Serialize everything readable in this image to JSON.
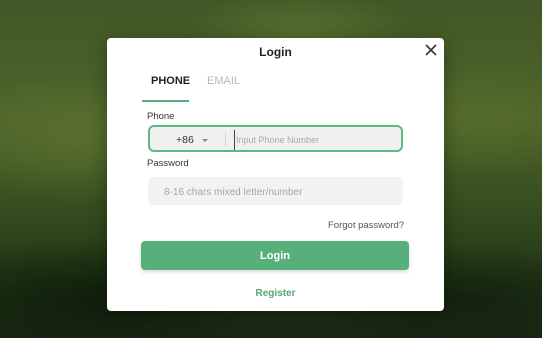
{
  "modal": {
    "title": "Login",
    "close_icon": "close-icon"
  },
  "tabs": [
    {
      "label": "PHONE",
      "active": true
    },
    {
      "label": "EMAIL",
      "active": false
    }
  ],
  "phone": {
    "label": "Phone",
    "country_code": "+86",
    "placeholder": "Input Phone Number",
    "value": ""
  },
  "password": {
    "label": "Password",
    "placeholder": "8-16 chars mixed letter/number",
    "value": ""
  },
  "links": {
    "forgot_password": "Forgot password?",
    "register": "Register"
  },
  "login_button": "Login",
  "colors": {
    "accent": "#57b07c",
    "accent_text": "#4ea873"
  }
}
